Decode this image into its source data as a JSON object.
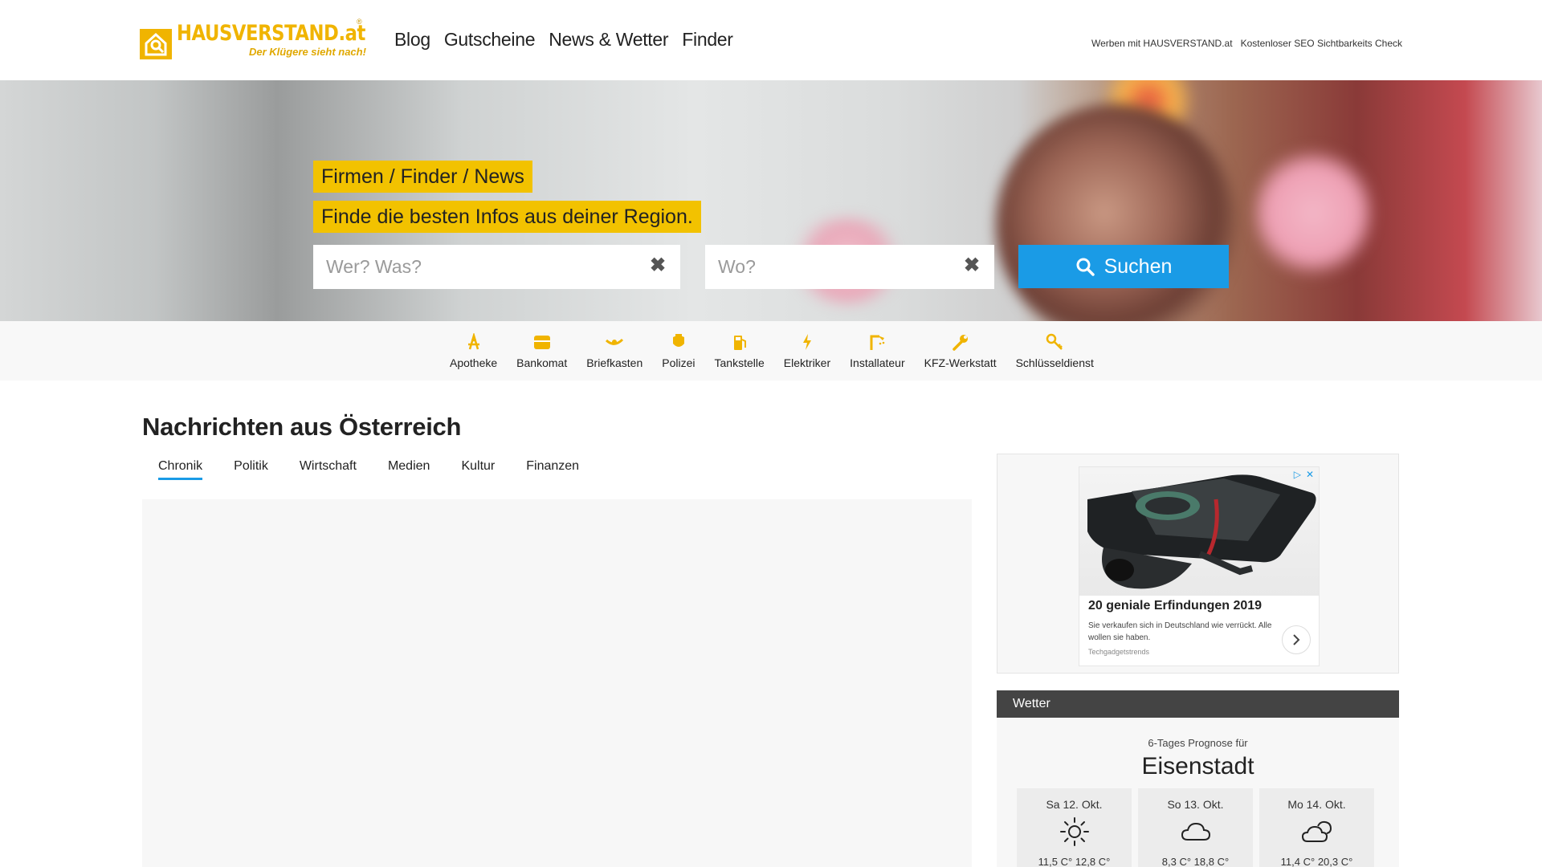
{
  "brand": {
    "name": "HAUSVERSTAND.at",
    "registered": "®",
    "tagline": "Der Klügere sieht nach!",
    "color": "#f0b400"
  },
  "nav": {
    "items": [
      {
        "label": "Blog"
      },
      {
        "label": "Gutscheine"
      },
      {
        "label": "News & Wetter"
      },
      {
        "label": "Finder"
      }
    ]
  },
  "top_links": [
    {
      "label": "Werben mit HAUSVERSTAND.at"
    },
    {
      "label": "Kostenloser SEO Sichtbarkeits Check"
    }
  ],
  "hero": {
    "title": "Firmen / Finder / News",
    "subtitle": "Finde die besten Infos aus deiner Region.",
    "what_placeholder": "Wer? Was?",
    "where_placeholder": "Wo?",
    "what_value": "",
    "where_value": "",
    "search_label": "Suchen",
    "accent": "#f2c200",
    "button_color": "#1a9be6"
  },
  "categories": [
    {
      "label": "Apotheke",
      "icon": "pharmacy-icon"
    },
    {
      "label": "Bankomat",
      "icon": "atm-icon"
    },
    {
      "label": "Briefkasten",
      "icon": "post-horn-icon"
    },
    {
      "label": "Polizei",
      "icon": "police-badge-icon"
    },
    {
      "label": "Tankstelle",
      "icon": "fuel-pump-icon"
    },
    {
      "label": "Elektriker",
      "icon": "lightning-icon"
    },
    {
      "label": "Installateur",
      "icon": "shower-icon"
    },
    {
      "label": "KFZ-Werkstatt",
      "icon": "wrench-icon"
    },
    {
      "label": "Schlüsseldienst",
      "icon": "key-icon"
    }
  ],
  "news": {
    "title": "Nachrichten aus Österreich",
    "tabs": [
      {
        "label": "Chronik",
        "active": true
      },
      {
        "label": "Politik",
        "active": false
      },
      {
        "label": "Wirtschaft",
        "active": false
      },
      {
        "label": "Medien",
        "active": false
      },
      {
        "label": "Kultur",
        "active": false
      },
      {
        "label": "Finanzen",
        "active": false
      }
    ]
  },
  "ad": {
    "title": "20 geniale Erfindungen 2019",
    "description": "Sie verkaufen sich in Deutschland wie verrückt. Alle wollen sie haben.",
    "source": "Techgadgetstrends"
  },
  "weather": {
    "header": "Wetter",
    "forecast_label": "6-Tages Prognose für",
    "city": "Eisenstadt",
    "days": [
      {
        "day": "Sa 12. Okt.",
        "icon": "sun-icon",
        "temps": "11,5 C° 12,8 C°"
      },
      {
        "day": "So 13. Okt.",
        "icon": "cloud-icon",
        "temps": "8,3 C° 18,8 C°"
      },
      {
        "day": "Mo 14. Okt.",
        "icon": "partly-cloudy-icon",
        "temps": "11,4 C° 20,3 C°"
      }
    ]
  }
}
